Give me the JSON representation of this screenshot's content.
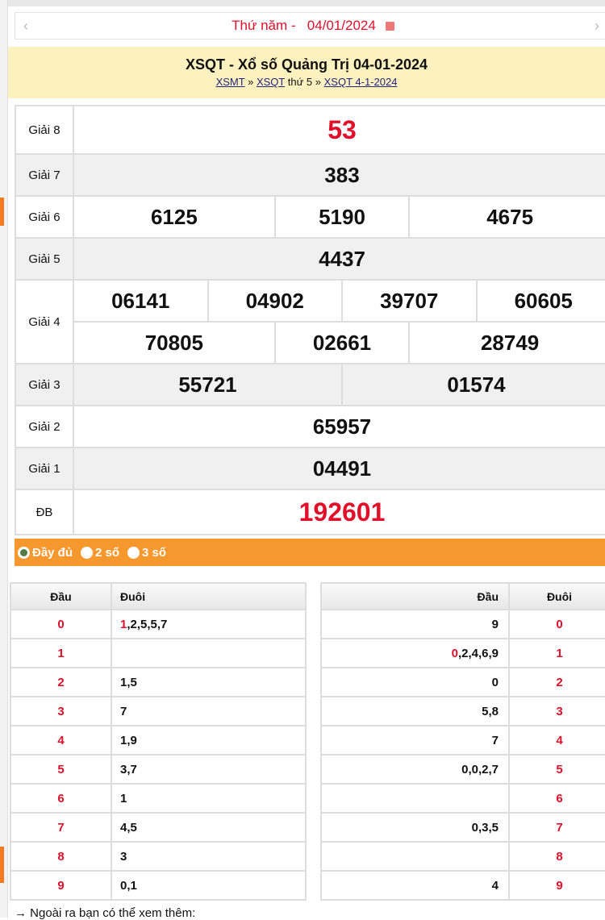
{
  "date_bar": {
    "label": "Thứ năm - ",
    "date": "04/01/2024",
    "prev": "‹",
    "next": "›"
  },
  "header": {
    "title": "XSQT - Xổ số Quảng Trị 04-01-2024",
    "breadcrumb": [
      "XSMT",
      "XSQT",
      "thứ 5",
      "XSQT 4-1-2024"
    ],
    "sep": "»"
  },
  "results": {
    "g8": {
      "label": "Giải 8",
      "numbers": [
        "53"
      ]
    },
    "g7": {
      "label": "Giải 7",
      "numbers": [
        "383"
      ]
    },
    "g6": {
      "label": "Giải 6",
      "numbers": [
        "6125",
        "5190",
        "4675"
      ]
    },
    "g5": {
      "label": "Giải 5",
      "numbers": [
        "4437"
      ]
    },
    "g4": {
      "label": "Giải 4",
      "numbers": [
        "06141",
        "04902",
        "39707",
        "60605",
        "70805",
        "02661",
        "28749"
      ]
    },
    "g3": {
      "label": "Giải 3",
      "numbers": [
        "55721",
        "01574"
      ]
    },
    "g2": {
      "label": "Giải 2",
      "numbers": [
        "65957"
      ]
    },
    "g1": {
      "label": "Giải 1",
      "numbers": [
        "04491"
      ]
    },
    "db": {
      "label": "ĐB",
      "numbers": [
        "192601"
      ]
    }
  },
  "options": [
    "Đầy đủ",
    "2 số",
    "3 số"
  ],
  "dau_table": {
    "headers": [
      "Đầu",
      "Đuôi"
    ],
    "rows": [
      {
        "k": "0",
        "hl": "1",
        "v": ",2,5,5,7"
      },
      {
        "k": "1",
        "hl": "",
        "v": ""
      },
      {
        "k": "2",
        "hl": "",
        "v": "1,5"
      },
      {
        "k": "3",
        "hl": "",
        "v": "7"
      },
      {
        "k": "4",
        "hl": "",
        "v": "1,9"
      },
      {
        "k": "5",
        "hl": "",
        "v": "3,7"
      },
      {
        "k": "6",
        "hl": "",
        "v": "1"
      },
      {
        "k": "7",
        "hl": "",
        "v": "4,5"
      },
      {
        "k": "8",
        "hl": "",
        "v": "3"
      },
      {
        "k": "9",
        "hl": "",
        "v": "0,1"
      }
    ]
  },
  "duoi_table": {
    "headers": [
      "Đầu",
      "Đuôi"
    ],
    "rows": [
      {
        "k": "0",
        "hl": "",
        "v": "9"
      },
      {
        "k": "1",
        "hl": "0",
        "v": ",2,4,6,9"
      },
      {
        "k": "2",
        "hl": "",
        "v": "0"
      },
      {
        "k": "3",
        "hl": "",
        "v": "5,8"
      },
      {
        "k": "4",
        "hl": "",
        "v": "7"
      },
      {
        "k": "5",
        "hl": "",
        "v": "0,0,2,7"
      },
      {
        "k": "6",
        "hl": "",
        "v": ""
      },
      {
        "k": "7",
        "hl": "",
        "v": "0,3,5"
      },
      {
        "k": "8",
        "hl": "",
        "v": ""
      },
      {
        "k": "9",
        "hl": "",
        "v": "4"
      }
    ]
  },
  "footer": "→ Ngoài ra bạn có thể xem thêm:"
}
